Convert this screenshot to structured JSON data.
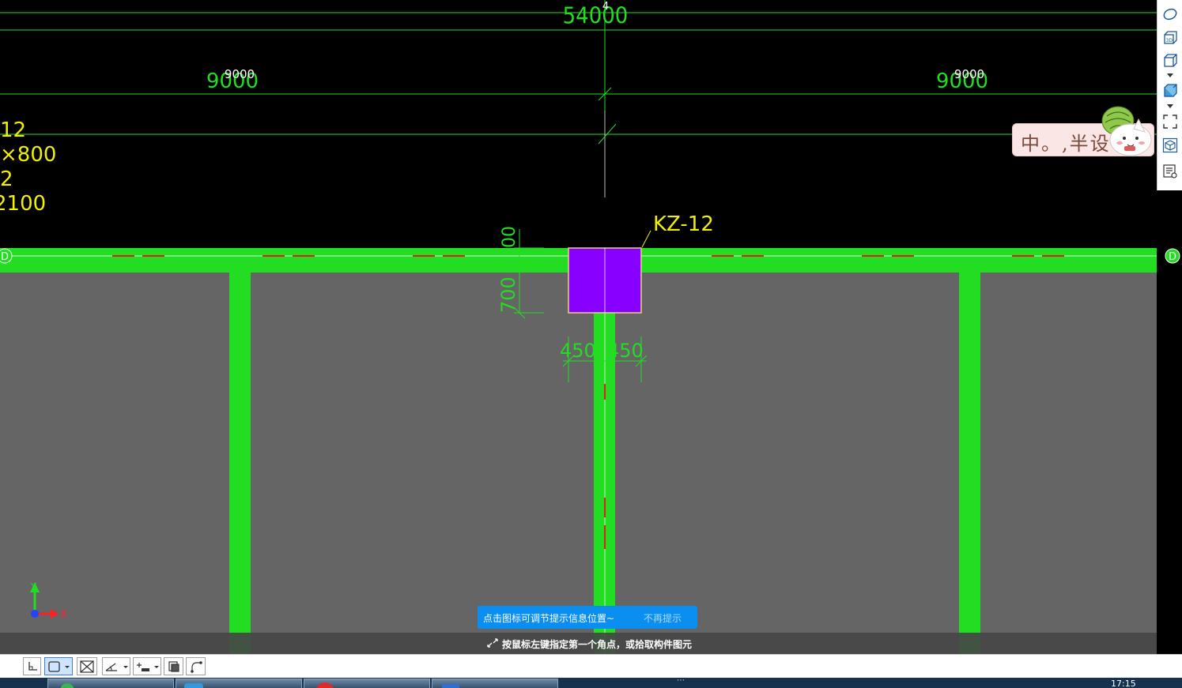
{
  "drawing": {
    "dimensions": {
      "total": "54000",
      "span_left": "9000",
      "span_right": "9000",
      "axis_number": "4",
      "column_depth": "700",
      "half_width_left": "450",
      "half_width_right": "450"
    },
    "axis_label_left": "D",
    "axis_label_right": "D",
    "column_label": "KZ-12",
    "left_annotation_lines": [
      "12",
      "×800",
      "2",
      "2100"
    ],
    "colors": {
      "background": "#000000",
      "floor": "#656565",
      "wall": "#22dd22",
      "column": "#8800ff",
      "column_outline": "#e8d27a",
      "dimension": "#22dd22",
      "annotation": "#f0f000",
      "axis": "#ff3030"
    },
    "ucs": {
      "x_label": "X",
      "y_label": "Y"
    }
  },
  "right_toolbar": {
    "items": [
      {
        "name": "dynamic-observe-icon"
      },
      {
        "name": "view-3d-icon"
      },
      {
        "name": "view-cube-icon"
      },
      {
        "name": "display-mode-icon"
      },
      {
        "name": "fullscreen-icon"
      },
      {
        "name": "select-element-icon"
      },
      {
        "name": "properties-list-icon"
      }
    ]
  },
  "ime": {
    "text": "中。,半设"
  },
  "hint": {
    "message": "点击图标可调节提示信息位置~",
    "dismiss": "不再提示"
  },
  "status": {
    "prompt": "按鼠标左键指定第一个角点，或拾取构件图元"
  },
  "bottom_toolbar": {
    "items": [
      {
        "name": "orthogonal-icon"
      },
      {
        "name": "object-snap-icon"
      },
      {
        "name": "cross-snap-icon"
      },
      {
        "name": "angle-snap-icon"
      },
      {
        "name": "dimension-input-icon"
      },
      {
        "name": "display-object-icon"
      },
      {
        "name": "arc-tool-icon"
      }
    ]
  },
  "taskbar": {
    "clock": "17:15",
    "items": [
      {
        "name": "taskbar-app-1",
        "color": "#39b54a"
      },
      {
        "name": "taskbar-app-2",
        "color": "#2f9ae0"
      },
      {
        "name": "taskbar-app-3",
        "color": "#e02a2a"
      },
      {
        "name": "taskbar-app-4",
        "color": "#2f6fd0"
      }
    ]
  }
}
